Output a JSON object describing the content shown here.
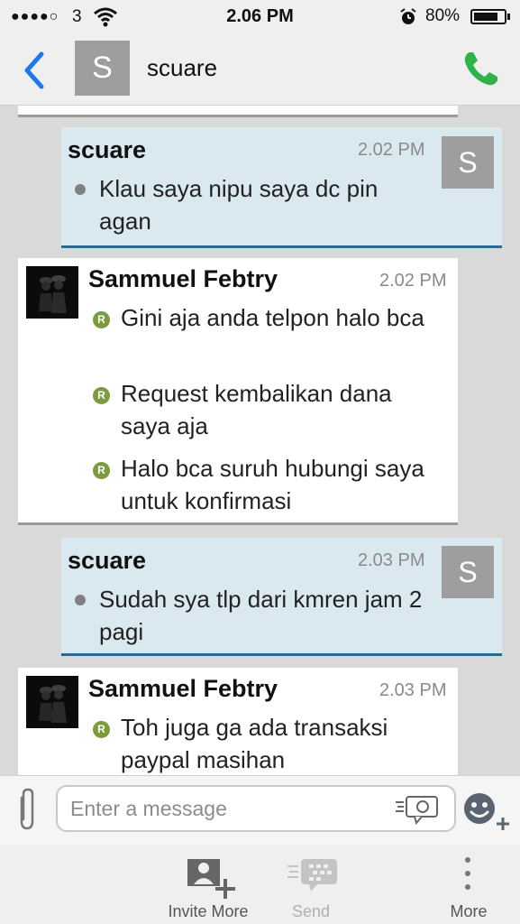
{
  "status_bar": {
    "signal": "●●●●○",
    "carrier": "3",
    "time": "2.06 PM",
    "battery": "80%",
    "battery_level": 0.8
  },
  "header": {
    "avatar_letter": "S",
    "title": "scuare",
    "back_icon": "chevron-left-icon",
    "call_icon": "phone-icon",
    "accent": "#1a7ae8",
    "call_color": "#2fb24a"
  },
  "messages": [
    {
      "sender": "scuare",
      "time": "2.02 PM",
      "avatar_letter": "S",
      "lines": [
        "Klau saya nipu saya dc pin agan"
      ]
    },
    {
      "sender": "Sammuel Febtry",
      "time": "2.02 PM",
      "status_mark": "R",
      "lines": [
        "Gini aja anda telpon halo bca",
        "Request kembalikan dana saya aja",
        "Halo bca suruh hubungi saya untuk konfirmasi"
      ]
    },
    {
      "sender": "scuare",
      "time": "2.03 PM",
      "avatar_letter": "S",
      "lines": [
        "Sudah sya tlp dari kmren jam 2 pagi"
      ]
    },
    {
      "sender": "Sammuel Febtry",
      "time": "2.03 PM",
      "status_mark": "R",
      "lines": [
        "Toh juga ga ada transaksi paypal masihan"
      ]
    }
  ],
  "composer": {
    "placeholder": "Enter a message"
  },
  "toolbar": {
    "invite_label": "Invite More",
    "send_label": "Send",
    "more_label": "More"
  }
}
